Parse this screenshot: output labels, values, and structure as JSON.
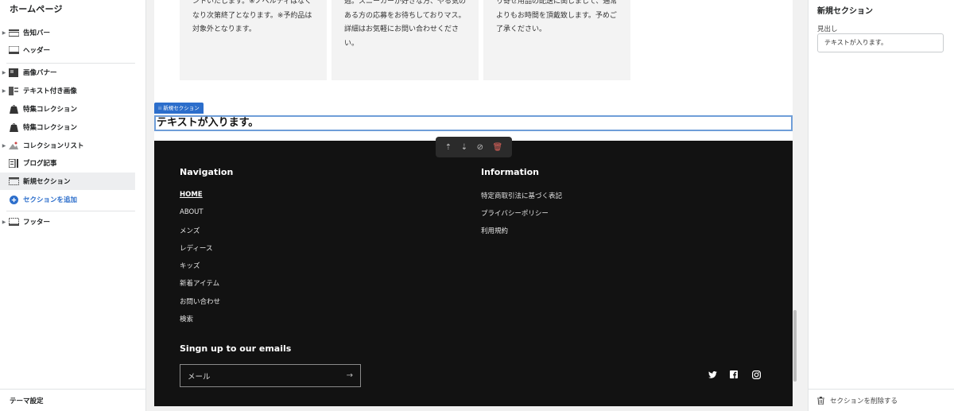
{
  "sidebar": {
    "title": "ホームページ",
    "items": [
      {
        "label": "告知バー",
        "icon": "announcement-bar-icon",
        "caret": true
      },
      {
        "label": "ヘッダー",
        "icon": "header-icon",
        "caret": false
      },
      {
        "label": "画像バナー",
        "icon": "image-banner-icon",
        "caret": true
      },
      {
        "label": "テキスト付き画像",
        "icon": "image-with-text-icon",
        "caret": true
      },
      {
        "label": "特集コレクション",
        "icon": "featured-collection-icon",
        "caret": false
      },
      {
        "label": "特集コレクション",
        "icon": "featured-collection-icon",
        "caret": false
      },
      {
        "label": "コレクションリスト",
        "icon": "collection-list-icon",
        "caret": true
      },
      {
        "label": "ブログ記事",
        "icon": "blog-posts-icon",
        "caret": false
      },
      {
        "label": "新規セクション",
        "icon": "new-section-icon",
        "caret": false,
        "active": true
      }
    ],
    "add_section": "セクションを追加",
    "footer_item": "フッター",
    "theme_settings": "テーマ設定"
  },
  "preview": {
    "cards": [
      {
        "text": "ントいたします。※ノベルティはなくなり次第終了となります。※予約品は対象外となります。"
      },
      {
        "text": "週。スニーカーが好きな方、やる気のある方の応募をお待ちしておりマス。詳細はお気軽にお問い合わせください。"
      },
      {
        "text": "り寄せ用品の配送に関しまして、通常よりもお時間を頂戴致します。予めご了承ください。"
      }
    ],
    "selected_tag": "新規セクション",
    "selected_heading": "テキストが入ります。",
    "footer": {
      "nav_heading": "Navigation",
      "nav_links": [
        "HOME",
        "ABOUT",
        "メンズ",
        "レディース",
        "キッズ",
        "新着アイテム",
        "お問い合わせ",
        "検索"
      ],
      "info_heading": "Information",
      "info_links": [
        "特定商取引法に基づく表記",
        "プライバシーポリシー",
        "利用規約"
      ],
      "signup_heading": "Singn up to our emails",
      "email_placeholder": "メール",
      "socials": [
        "twitter-icon",
        "facebook-icon",
        "instagram-icon"
      ]
    }
  },
  "panel": {
    "title": "新規セクション",
    "field_label": "見出し",
    "field_value": "テキストが入ります。",
    "delete_label": "セクションを削除する"
  },
  "colors": {
    "accent": "#2c6ecb",
    "footer_bg": "#121212",
    "delete": "#e0635b"
  }
}
